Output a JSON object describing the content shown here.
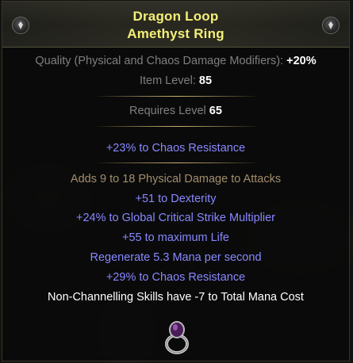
{
  "item": {
    "name": "Dragon Loop",
    "base": "Amethyst Ring"
  },
  "properties": {
    "quality_label": "Quality (Physical and Chaos Damage Modifiers): ",
    "quality_value": "+20%",
    "item_level_label": "Item Level: ",
    "item_level_value": "85"
  },
  "requirements": {
    "label": "Requires Level ",
    "value": "65"
  },
  "implicit": "+23% to Chaos Resistance",
  "mods": [
    "Adds 9 to 18 Physical Damage to Attacks",
    "+51 to Dexterity",
    "+24% to Global Critical Strike Multiplier",
    "+55 to maximum Life",
    "Regenerate 5.3 Mana per second",
    "+29% to Chaos Resistance",
    "Non-Channelling Skills have -7 to Total Mana Cost"
  ],
  "icons": {
    "header_left": "influence-icon",
    "header_right": "influence-icon",
    "item_art": "amethyst-ring-icon"
  },
  "colors": {
    "title": "#f3f077",
    "property_label": "#7f7f7f",
    "magic_mod": "#8888ff",
    "crafted_first_mod": "#a38d6d",
    "white_mod": "#ffffff"
  }
}
